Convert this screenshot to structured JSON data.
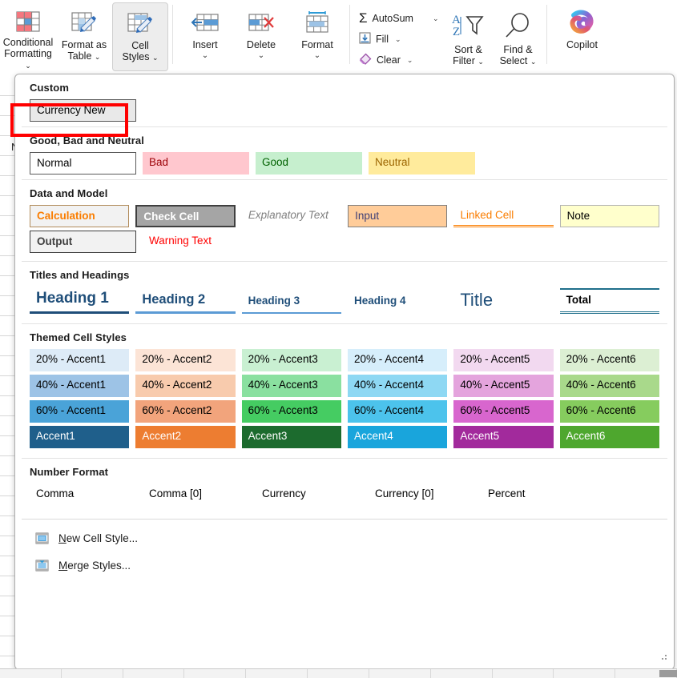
{
  "ribbon": {
    "buttons": [
      {
        "name": "conditional-formatting",
        "label_line1": "Conditional",
        "label_line2": "Formatting",
        "has_caret": true,
        "icon": "conditional-formatting-icon"
      },
      {
        "name": "format-as-table",
        "label_line1": "Format as",
        "label_line2": "Table",
        "has_caret": true,
        "icon": "format-as-table-icon"
      },
      {
        "name": "cell-styles",
        "label_line1": "Cell",
        "label_line2": "Styles",
        "has_caret": true,
        "icon": "cell-styles-icon",
        "selected": true
      },
      {
        "name": "insert",
        "label_line1": "Insert",
        "label_line2": "",
        "has_caret": true,
        "icon": "insert-cells-icon"
      },
      {
        "name": "delete",
        "label_line1": "Delete",
        "label_line2": "",
        "has_caret": true,
        "icon": "delete-cells-icon"
      },
      {
        "name": "format",
        "label_line1": "Format",
        "label_line2": "",
        "has_caret": true,
        "icon": "format-cells-icon"
      }
    ],
    "editing": [
      {
        "name": "autosum",
        "label": "AutoSum",
        "icon": "sigma-icon",
        "has_caret": true
      },
      {
        "name": "fill",
        "label": "Fill",
        "icon": "fill-down-icon",
        "has_caret": true
      },
      {
        "name": "clear",
        "label": "Clear",
        "icon": "eraser-icon",
        "has_caret": true
      }
    ],
    "sort_filter": {
      "label_line1": "Sort &",
      "label_line2": "Filter",
      "icon": "sort-filter-icon",
      "has_caret": true
    },
    "find_select": {
      "label_line1": "Find &",
      "label_line2": "Select",
      "icon": "magnifier-icon",
      "has_caret": true
    },
    "copilot": {
      "label": "Copilot",
      "icon": "copilot-icon"
    }
  },
  "background": {
    "ghost_cell_text": "N"
  },
  "gallery": {
    "groups": [
      {
        "name": "custom",
        "title": "Custom",
        "rows": [
          [
            {
              "label": "Currency New",
              "style": "s-custom",
              "width": "w-std"
            }
          ]
        ]
      },
      {
        "name": "good-bad-neutral",
        "title": "Good, Bad and Neutral",
        "rows": [
          [
            {
              "label": "Normal",
              "style": "s-normal",
              "width": "w-std"
            },
            {
              "label": "Bad",
              "style": "s-bad",
              "width": "w-std"
            },
            {
              "label": "Good",
              "style": "s-good",
              "width": "w-std"
            },
            {
              "label": "Neutral",
              "style": "s-neutral",
              "width": "w-std"
            }
          ]
        ]
      },
      {
        "name": "data-and-model",
        "title": "Data and Model",
        "rows": [
          [
            {
              "label": "Calculation",
              "style": "s-calc",
              "width": "w-std"
            },
            {
              "label": "Check Cell",
              "style": "s-check",
              "width": "w-std"
            },
            {
              "label": "Explanatory Text",
              "style": "s-expl",
              "width": "w-std"
            },
            {
              "label": "Input",
              "style": "s-input",
              "width": "w-std"
            },
            {
              "label": "Linked Cell",
              "style": "s-linked",
              "width": "w-std"
            },
            {
              "label": "Note",
              "style": "s-note",
              "width": "w-std"
            }
          ],
          [
            {
              "label": "Output",
              "style": "s-output",
              "width": "w-std"
            },
            {
              "label": "Warning Text",
              "style": "s-warn",
              "width": "w-std"
            }
          ]
        ]
      },
      {
        "name": "titles-and-headings",
        "title": "Titles and Headings",
        "rows": [
          [
            {
              "label": "Heading 1",
              "style": "s-h1",
              "width": "w-std"
            },
            {
              "label": "Heading 2",
              "style": "s-h2",
              "width": "w-std"
            },
            {
              "label": "Heading 3",
              "style": "s-h3",
              "width": "w-std"
            },
            {
              "label": "Heading 4",
              "style": "s-h4",
              "width": "w-std"
            },
            {
              "label": "Title",
              "style": "s-title",
              "width": "w-std"
            },
            {
              "label": "Total",
              "style": "s-total",
              "width": "w-std"
            }
          ]
        ]
      },
      {
        "name": "themed-cell-styles",
        "title": "Themed Cell Styles",
        "rows": [
          [
            {
              "label": "20% - Accent1",
              "bg": "#ddebf7",
              "fg": "#000000",
              "width": "w-std"
            },
            {
              "label": "20% - Accent2",
              "bg": "#fce4d6",
              "fg": "#000000",
              "width": "w-std"
            },
            {
              "label": "20% - Accent3",
              "bg": "#c9f0d2",
              "fg": "#000000",
              "width": "w-std"
            },
            {
              "label": "20% - Accent4",
              "bg": "#d6eefb",
              "fg": "#000000",
              "width": "w-std"
            },
            {
              "label": "20% - Accent5",
              "bg": "#f2d9f0",
              "fg": "#000000",
              "width": "w-std"
            },
            {
              "label": "20% - Accent6",
              "bg": "#dcefd3",
              "fg": "#000000",
              "width": "w-std"
            }
          ],
          [
            {
              "label": "40% - Accent1",
              "bg": "#9dc3e6",
              "fg": "#000000",
              "width": "w-std"
            },
            {
              "label": "40% - Accent2",
              "bg": "#f8cbad",
              "fg": "#000000",
              "width": "w-std"
            },
            {
              "label": "40% - Accent3",
              "bg": "#8ae0a0",
              "fg": "#000000",
              "width": "w-std"
            },
            {
              "label": "40% - Accent4",
              "bg": "#8ed8f3",
              "fg": "#000000",
              "width": "w-std"
            },
            {
              "label": "40% - Accent5",
              "bg": "#e4a4dd",
              "fg": "#000000",
              "width": "w-std"
            },
            {
              "label": "40% - Accent6",
              "bg": "#a9d98b",
              "fg": "#000000",
              "width": "w-std"
            }
          ],
          [
            {
              "label": "60% - Accent1",
              "bg": "#4aa3d8",
              "fg": "#000000",
              "width": "w-std"
            },
            {
              "label": "60% - Accent2",
              "bg": "#f2a47c",
              "fg": "#000000",
              "width": "w-std"
            },
            {
              "label": "60% - Accent3",
              "bg": "#45cc62",
              "fg": "#000000",
              "width": "w-std"
            },
            {
              "label": "60% - Accent4",
              "bg": "#4cc3ec",
              "fg": "#000000",
              "width": "w-std"
            },
            {
              "label": "60% - Accent5",
              "bg": "#d濃",
              "fg": "#000000",
              "width": "w-std"
            },
            {
              "label": "60% - Accent6",
              "bg": "#86cc5e",
              "fg": "#000000",
              "width": "w-std"
            }
          ],
          [
            {
              "label": "Accent1",
              "bg": "#1f5f8b",
              "fg": "#ffffff",
              "width": "w-std"
            },
            {
              "label": "Accent2",
              "bg": "#ed7d31",
              "fg": "#ffffff",
              "width": "w-std"
            },
            {
              "label": "Accent3",
              "bg": "#1c6b2e",
              "fg": "#ffffff",
              "width": "w-std"
            },
            {
              "label": "Accent4",
              "bg": "#19a5dc",
              "fg": "#ffffff",
              "width": "w-std"
            },
            {
              "label": "Accent5",
              "bg": "#a22a9c",
              "fg": "#ffffff",
              "width": "w-std"
            },
            {
              "label": "Accent6",
              "bg": "#4ea72e",
              "fg": "#ffffff",
              "width": "w-std"
            }
          ]
        ]
      },
      {
        "name": "number-format",
        "title": "Number Format",
        "rows": [
          [
            {
              "label": "Comma",
              "style": "s-num",
              "width": "w-std"
            },
            {
              "label": "Comma [0]",
              "style": "s-num",
              "width": "w-std"
            },
            {
              "label": "Currency",
              "style": "s-num",
              "width": "w-std"
            },
            {
              "label": "Currency [0]",
              "style": "s-num",
              "width": "w-std"
            },
            {
              "label": "Percent",
              "style": "s-num",
              "width": "w-std"
            }
          ]
        ]
      }
    ],
    "commands": [
      {
        "name": "new-cell-style",
        "label_pre": "",
        "label_key": "N",
        "label_post": "ew Cell Style...",
        "icon": "new-cell-style-icon"
      },
      {
        "name": "merge-styles",
        "label_pre": "",
        "label_key": "M",
        "label_post": "erge Styles...",
        "icon": "merge-styles-icon"
      }
    ]
  },
  "annotation": {
    "target": "Currency New",
    "color": "#ff0000"
  }
}
